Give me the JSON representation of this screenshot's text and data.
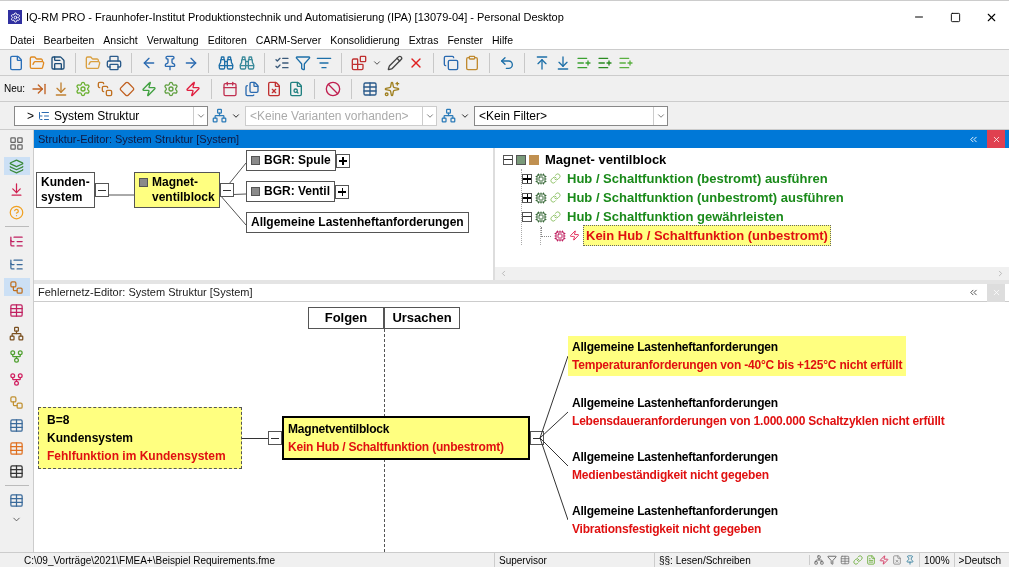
{
  "window": {
    "title": "IQ-RM PRO - Fraunhofer-Institut Produktionstechnik und Automatisierung (IPA) [13079-04] - Personal Desktop"
  },
  "menu": [
    "Datei",
    "Bearbeiten",
    "Ansicht",
    "Verwaltung",
    "Editoren",
    "CARM-Server",
    "Konsolidierung",
    "Extras",
    "Fenster",
    "Hilfe"
  ],
  "toolbar_new_label": "Neu:",
  "selectors": [
    {
      "prefix": ">",
      "value": "System Struktur",
      "disabled": false
    },
    {
      "placeholder": "<Keine Varianten vorhanden>",
      "disabled": true
    },
    {
      "value": "<Kein Filter>",
      "disabled": false
    }
  ],
  "structure_editor": {
    "title": "Struktur-Editor: System Struktur [System]",
    "active": true,
    "root": {
      "lines": [
        "Kunden-",
        "system"
      ],
      "selected": false,
      "expanded": true,
      "children": [
        {
          "lines": [
            "Magnet-",
            "ventilblock"
          ],
          "selected": true,
          "expanded": true,
          "children": [
            {
              "lines": [
                "BGR: Spule"
              ],
              "selected": false,
              "expanded": false
            },
            {
              "lines": [
                "BGR: Ventil"
              ],
              "selected": false,
              "expanded": false
            },
            {
              "lines": [
                "Allgemeine Lastenheftanforderungen"
              ],
              "selected": false
            }
          ]
        }
      ]
    }
  },
  "tree": [
    {
      "label": "Magnet- ventilblock",
      "kind": "component",
      "expanded": true,
      "selected": false,
      "children": [
        {
          "label": "Hub / Schaltfunktion (bestromt) ausführen",
          "kind": "function",
          "expanded": false,
          "selected": false
        },
        {
          "label": "Hub / Schaltfunktion (unbestromt) ausführen",
          "kind": "function",
          "expanded": false,
          "selected": false
        },
        {
          "label": "Hub / Schaltfunktion gewährleisten",
          "kind": "function",
          "expanded": true,
          "selected": false,
          "children": [
            {
              "label": "Kein Hub / Schaltfunktion (unbestromt)",
              "kind": "malfunction",
              "selected": true
            }
          ]
        }
      ]
    }
  ],
  "failure_net": {
    "title": "Fehlernetz-Editor: System Struktur [System]",
    "active": false,
    "columns": [
      "Folgen",
      "Ursachen"
    ],
    "effect": {
      "rating": "B=8",
      "element": "Kundensystem",
      "failure": "Fehlfunktion im Kundensystem",
      "expanded": true
    },
    "focus": {
      "element": "Magnetventilblock",
      "failure": "Kein Hub / Schaltfunktion (unbestromt)",
      "expanded": true
    },
    "causes": [
      {
        "element": "Allgemeine Lastenheftanforderungen",
        "failure": "Temperaturanforderungen von -40°C bis +125°C nicht erfüllt",
        "selected": true
      },
      {
        "element": "Allgemeine Lastenheftanforderungen",
        "failure": "Lebensdaueranforderungen von 1.000.000 Schaltzyklen nicht erfüllt",
        "selected": false
      },
      {
        "element": "Allgemeine Lastenheftanforderungen",
        "failure": "Medienbeständigkeit nicht gegeben",
        "selected": false
      },
      {
        "element": "Allgemeine Lastenheftanforderungen",
        "failure": "Vibrationsfestigkeit nicht gegeben",
        "selected": false
      }
    ]
  },
  "status_bar": {
    "path": "C:\\09_Vorträge\\2021\\FMEA+\\Beispiel Requirements.fme",
    "user": "Supervisor",
    "rights": "§§: Lesen/Schreiben",
    "zoom": "100%",
    "language": ">Deutsch"
  }
}
